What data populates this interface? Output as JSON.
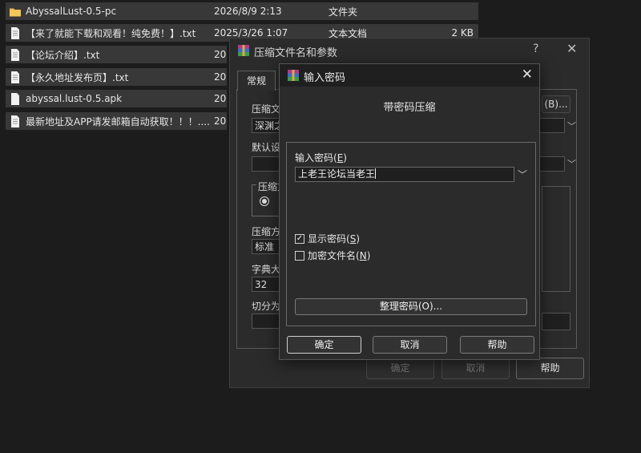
{
  "files": [
    {
      "name": "AbyssalLust-0.5-pc",
      "date": "2026/8/9 2:13",
      "type": "文件夹",
      "size": "",
      "icon": "folder"
    },
    {
      "name": "【来了就能下载和观看！纯免费！】.txt",
      "date": "2025/3/26 1:07",
      "type": "文本文档",
      "size": "2 KB",
      "icon": "text"
    },
    {
      "name": "【论坛介绍】.txt",
      "date": "202",
      "type": "",
      "size": "",
      "icon": "text"
    },
    {
      "name": "【永久地址发布页】.txt",
      "date": "202",
      "type": "",
      "size": "",
      "icon": "text"
    },
    {
      "name": "abyssal.lust-0.5.apk",
      "date": "202",
      "type": "",
      "size": "",
      "icon": "file"
    },
    {
      "name": "最新地址及APP请发邮箱自动获取！！！....",
      "date": "202",
      "type": "",
      "size": "",
      "icon": "text"
    }
  ],
  "archive_dialog": {
    "title": "压缩文件名和参数",
    "help_mark": "?",
    "close": "✕",
    "tab_general": "常规",
    "archive_name_label": "压缩文",
    "archive_name_value": "深渊之",
    "browse_label": "(B)...",
    "default_label": "默认设",
    "format_group": "压缩文",
    "method_label": "压缩方",
    "method_value": "标准",
    "dict_label": "字典大",
    "dict_value": "32",
    "split_label": "切分为",
    "ok": "确定",
    "cancel": "取消",
    "help": "帮助"
  },
  "password_dialog": {
    "title": "输入密码",
    "heading": "带密码压缩",
    "pw_label": "输入密码",
    "pw_label_key": "E",
    "pw_value": "上老王论坛当老王",
    "show_pw": "显示密码",
    "show_pw_key": "S",
    "show_pw_checked": "✓",
    "encrypt_names": "加密文件名",
    "encrypt_names_key": "N",
    "organize": "整理密码(O)...",
    "ok": "确定",
    "cancel": "取消",
    "help": "帮助"
  },
  "colors": {
    "background": "#1c1c1c",
    "row": "#383838",
    "dialog": "#2b2b2b",
    "folder": "#e8b94a"
  }
}
